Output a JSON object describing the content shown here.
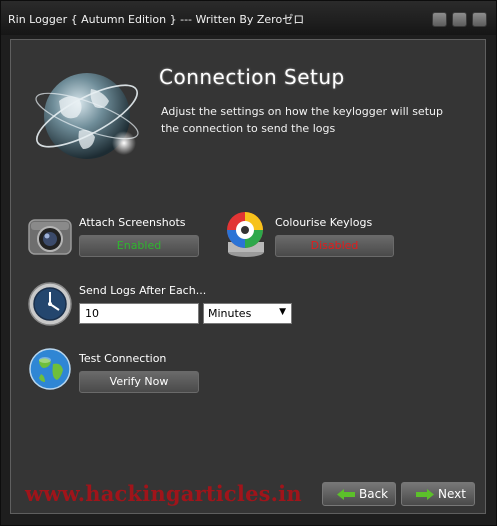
{
  "window": {
    "title": "Rin Logger  { Autumn Edition } --- Written By Zeroゼロ"
  },
  "header": {
    "heading": "Connection Setup",
    "description": "Adjust the settings on how the keylogger will setup the connection to send the logs"
  },
  "options": {
    "screenshots": {
      "label": "Attach Screenshots",
      "button": "Enabled",
      "color": "#2fb62f"
    },
    "colourise": {
      "label": "Colourise Keylogs",
      "button": "Disabled",
      "color": "#e21c1c"
    },
    "send_logs": {
      "label": "Send Logs After Each...",
      "value": "10",
      "unit_selected": "Minutes"
    },
    "test_connection": {
      "label": "Test Connection",
      "button": "Verify Now"
    }
  },
  "nav": {
    "back_label": "Back",
    "next_label": "Next",
    "arrow_color": "#5cc02a"
  },
  "watermark": {
    "text": "www.hackingarticles.in"
  },
  "icons": [
    "globe-icon",
    "camera-icon",
    "color-wheel-icon",
    "clock-icon",
    "earth-icon",
    "back-arrow-icon",
    "next-arrow-icon"
  ]
}
